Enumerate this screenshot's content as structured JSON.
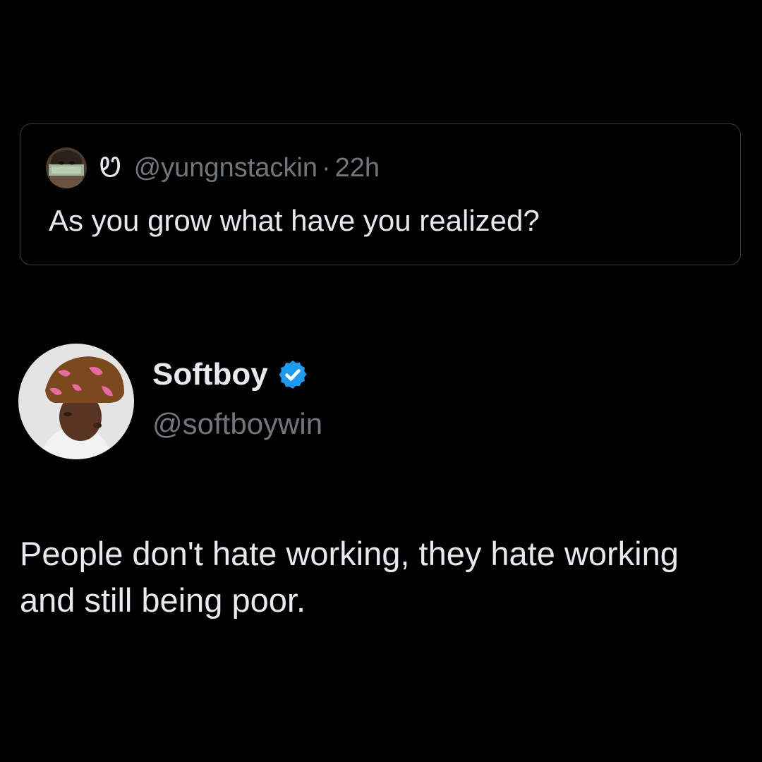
{
  "quoted_post": {
    "display_name": "Ꮼ",
    "handle": "@yungnstackin",
    "separator": "·",
    "time": "22h",
    "text": "As you grow what have you realized?",
    "avatar_icon": "money-mask-avatar"
  },
  "post": {
    "display_name": "Softboy",
    "verified_icon": "verified-badge-icon",
    "handle": "@softboywin",
    "text": "People don't hate working, they hate working and still being poor.",
    "avatar_icon": "user-avatar"
  },
  "colors": {
    "background": "#000000",
    "text_primary": "#e7e9ea",
    "text_secondary": "#71767b",
    "card_border": "#3a3d41",
    "verified_blue": "#1d9bf0"
  }
}
